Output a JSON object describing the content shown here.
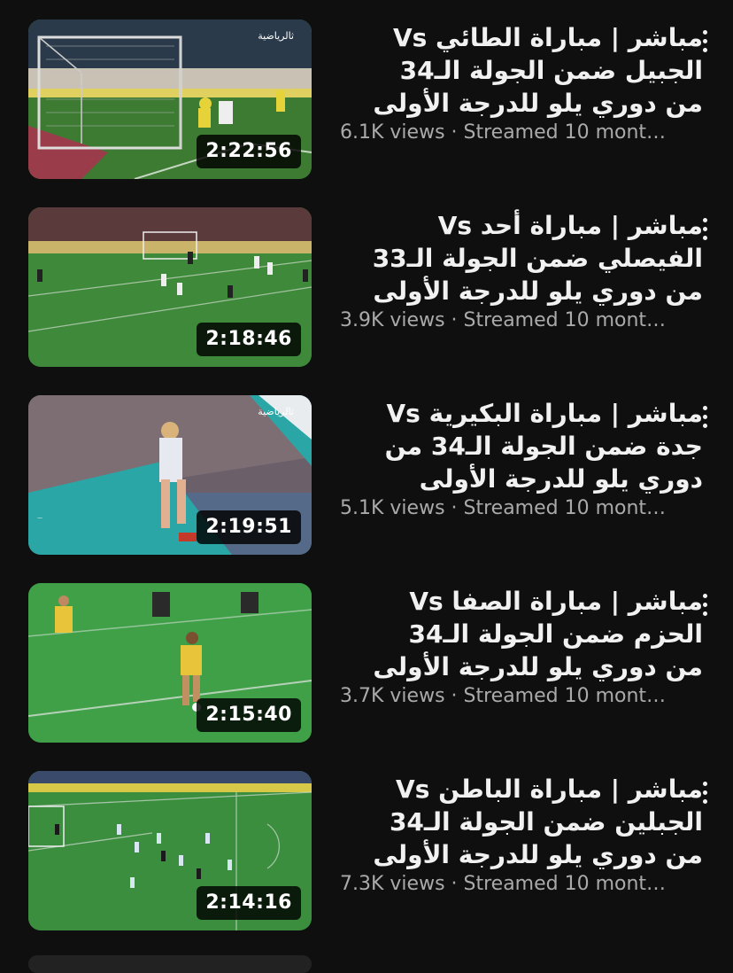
{
  "videos": [
    {
      "title": "مباشر | مباراة الطائي Vs الجبيل ضمن الجولة الـ34 من دوري يلو للدرجة الأولى",
      "views": "6.1K views",
      "streamed": "Streamed 10 mont…",
      "duration": "2:22:56"
    },
    {
      "title": "مباشر | مباراة أحد Vs الفيصلي ضمن الجولة الـ33 من دوري يلو للدرجة الأولى",
      "views": "3.9K views",
      "streamed": "Streamed 10 mont…",
      "duration": "2:18:46"
    },
    {
      "title": "مباشر | مباراة البكيرية Vs جدة ضمن الجولة الـ34 من دوري يلو للدرجة الأولى",
      "views": "5.1K views",
      "streamed": "Streamed 10 mont…",
      "duration": "2:19:51"
    },
    {
      "title": "مباشر | مباراة الصفا Vs الحزم ضمن الجولة الـ34 من دوري يلو للدرجة الأولى",
      "views": "3.7K views",
      "streamed": "Streamed 10 mont…",
      "duration": "2:15:40"
    },
    {
      "title": "مباشر | مباراة الباطن Vs الجبلين ضمن الجولة الـ34 من دوري يلو للدرجة الأولى",
      "views": "7.3K views",
      "streamed": "Streamed 10 mont…",
      "duration": "2:14:16"
    }
  ],
  "separator": " · ",
  "icons": {
    "more": "vertical-ellipsis-icon"
  }
}
